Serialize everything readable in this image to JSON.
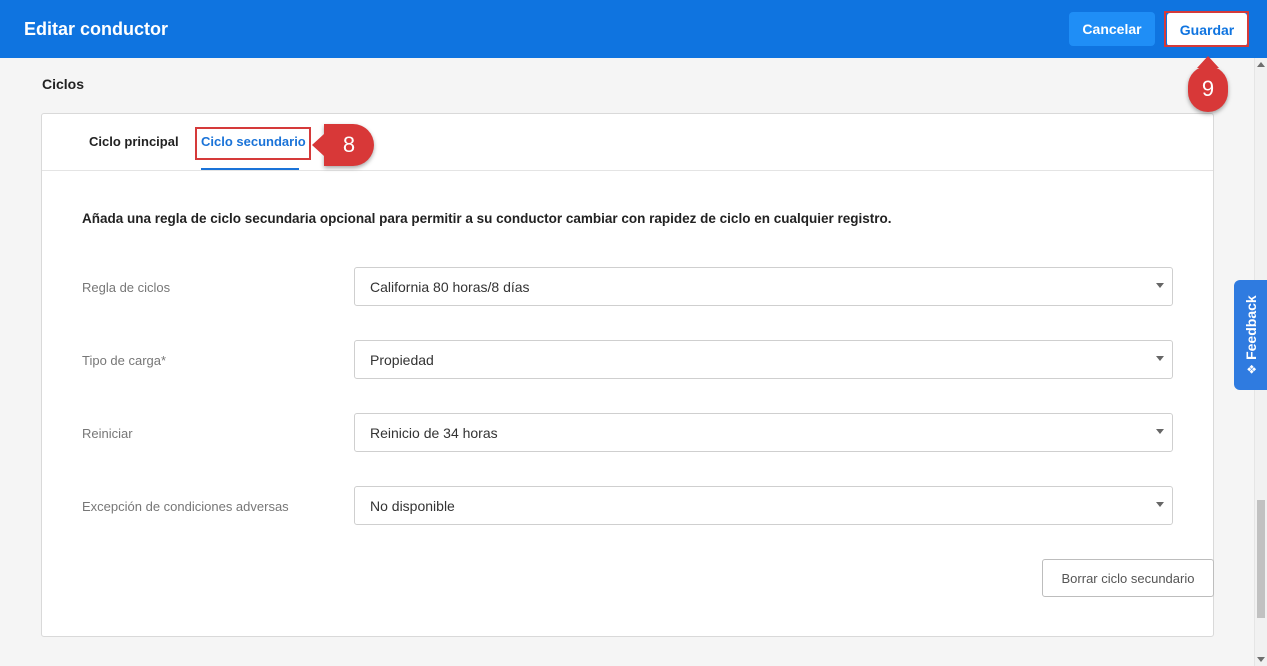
{
  "header": {
    "title": "Editar conductor",
    "cancel_label": "Cancelar",
    "save_label": "Guardar"
  },
  "section": {
    "title": "Ciclos"
  },
  "tabs": [
    {
      "label": "Ciclo principal",
      "active": false
    },
    {
      "label": "Ciclo secundario",
      "active": true
    }
  ],
  "form": {
    "intro": "Añada una regla de ciclo secundaria opcional para permitir a su conductor cambiar con rapidez de ciclo en cualquier registro.",
    "rows": [
      {
        "label": "Regla de ciclos",
        "value": "California 80 horas/8 días"
      },
      {
        "label": "Tipo de carga*",
        "value": "Propiedad"
      },
      {
        "label": "Reiniciar",
        "value": "Reinicio de 34 horas"
      },
      {
        "label": "Excepción de condiciones adversas",
        "value": "No disponible"
      }
    ],
    "clear_label": "Borrar ciclo secundario"
  },
  "feedback": {
    "label": "Feedback"
  },
  "callouts": {
    "step8": "8",
    "step9": "9"
  },
  "colors": {
    "header_bg": "#0f74e0",
    "accent": "#1a73d8",
    "callout": "#d83838"
  }
}
